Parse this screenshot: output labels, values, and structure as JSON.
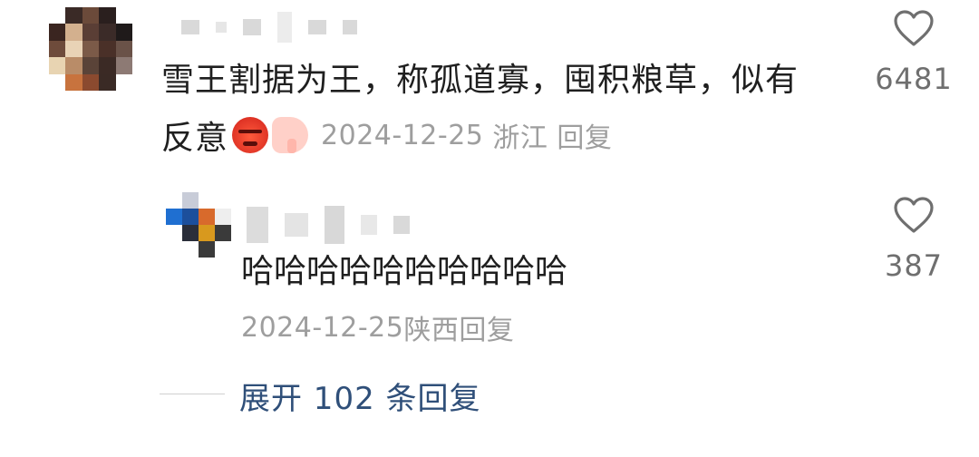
{
  "comment": {
    "text_line1": "雪王割据为王，称孤道寡，囤积粮草，似有",
    "text_line2": "反意",
    "emojis": [
      "angry-face-emoji",
      "thumbs-down-emoji"
    ],
    "date": "2024-12-25",
    "location": "浙江",
    "reply_label": "回复",
    "likes": "6481"
  },
  "reply": {
    "text": "哈哈哈哈哈哈哈哈哈哈",
    "date": "2024-12-25",
    "location": "陕西",
    "reply_label": "回复",
    "likes": "387"
  },
  "expand": {
    "label": "展开 102 条回复"
  },
  "colors": {
    "text": "#1f1f1f",
    "meta": "#9e9e9e",
    "link": "#2f4f79",
    "icon": "#6f6f6f"
  }
}
